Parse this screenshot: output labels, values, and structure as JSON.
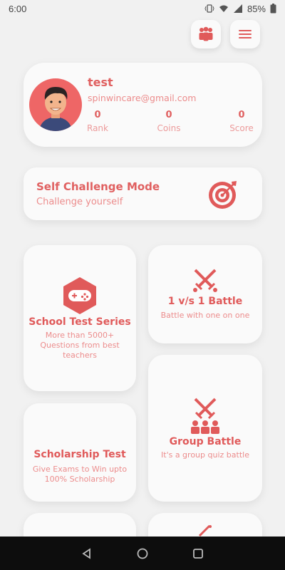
{
  "status_bar": {
    "time": "6:00",
    "battery": "85%"
  },
  "header": {
    "group_icon": "group-icon",
    "menu_icon": "hamburger-menu-icon"
  },
  "profile": {
    "name": "test",
    "email": "spinwincare@gmail.com",
    "stats": [
      {
        "value": "0",
        "label": "Rank"
      },
      {
        "value": "0",
        "label": "Coins"
      },
      {
        "value": "0",
        "label": "Score"
      }
    ]
  },
  "challenge": {
    "title": "Self Challenge Mode",
    "subtitle": "Challenge yourself",
    "icon": "target-icon"
  },
  "tiles": {
    "school": {
      "title": "School Test Series",
      "subtitle_l1": "More than 5000+",
      "subtitle_l2": "Questions from best",
      "subtitle_l3": "teachers",
      "icon": "gamepad-icon"
    },
    "battle": {
      "title": "1 v/s 1 Battle",
      "subtitle": "Battle with one on one",
      "icon": "crossed-swords-icon"
    },
    "scholarship": {
      "title": "Scholarship Test",
      "subtitle_l1": "Give Exams to Win upto",
      "subtitle_l2": "100% Scholarship"
    },
    "group": {
      "title": "Group Battle",
      "subtitle": "It's a group quiz battle",
      "icon": "group-battle-icon"
    }
  },
  "colors": {
    "accent": "#e05a5a",
    "accent_light": "#ec8c8c",
    "background": "#f1f1f1",
    "card": "#fafafa"
  }
}
